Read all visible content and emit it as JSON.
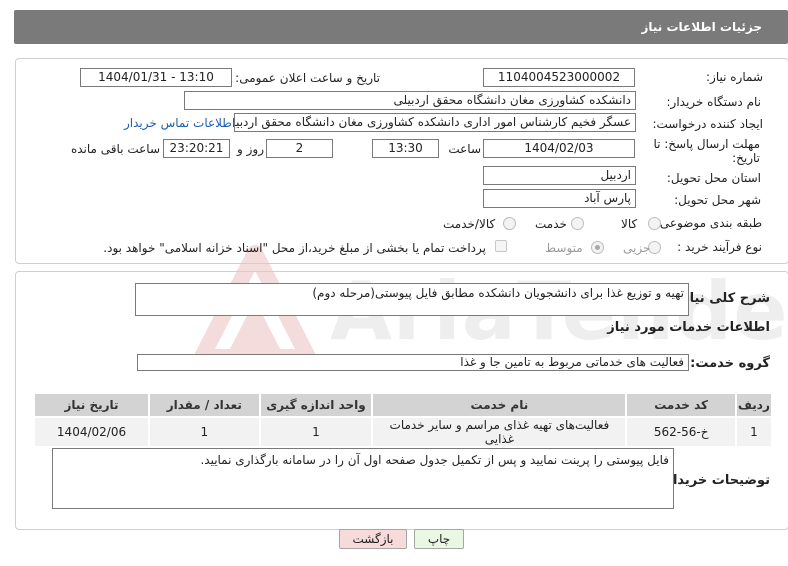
{
  "header": {
    "title": "جزئیات اطلاعات نیاز"
  },
  "labels": {
    "need_number": "شماره نیاز:",
    "announce_datetime": "تاریخ و ساعت اعلان عمومی:",
    "buyer_org": "نام دستگاه خریدار:",
    "requester": "ایجاد کننده درخواست:",
    "contact_link": "اطلاعات تماس خریدار",
    "deadline_line1": "مهلت ارسال پاسخ: تا",
    "deadline_line2": "تاریخ:",
    "hour": "ساعت",
    "day_and": "روز و",
    "hours_left": "ساعت باقی مانده",
    "province": "استان محل تحویل:",
    "city": "شهر محل تحویل:",
    "category": "طبقه بندی موضوعی:",
    "process": "نوع فرآیند خرید :",
    "need_desc": "شرح کلی نیاز:",
    "services_info": "اطلاعات خدمات مورد نیاز",
    "service_group": "گروه خدمت:",
    "buyer_notes": "توضیحات خریدار:"
  },
  "fields": {
    "need_number": "1104004523000002",
    "announce_datetime": "1404/01/31 - 13:10",
    "buyer_org": "دانشکده کشاورزی مغان دانشگاه محقق اردبیلی",
    "requester": "عسگر فخیم کارشناس امور اداری دانشکده کشاورزی مغان دانشگاه محقق اردبیلی",
    "deadline_date": "1404/02/03",
    "deadline_time": "13:30",
    "days_left": "2",
    "time_left": "23:20:21",
    "province": "اردبیل",
    "city": "پارس آباد",
    "need_desc": "تهیه و توزیع غذا برای دانشجویان دانشکده مطابق فایل پیوستی(مرحله دوم)",
    "service_group": "فعالیت های خدماتی مربوط به تامین جا و غذا",
    "buyer_notes": "فایل پیوستی را پرینت نمایید و پس از تکمیل جدول صفحه اول آن را در سامانه بارگذاری نمایید."
  },
  "category_options": [
    {
      "label": "کالا",
      "selected": false
    },
    {
      "label": "خدمت",
      "selected": false
    },
    {
      "label": "کالا/خدمت",
      "selected": false
    }
  ],
  "process_options": [
    {
      "label": "جزیی",
      "selected": false
    },
    {
      "label": "متوسط",
      "selected": true
    }
  ],
  "payment_note": "پرداخت تمام یا بخشی از مبلغ خرید،از محل \"اسناد خزانه اسلامی\" خواهد بود.",
  "services_table": {
    "headers": [
      "ردیف",
      "کد خدمت",
      "نام خدمت",
      "واحد اندازه گیری",
      "تعداد / مقدار",
      "تاریخ نیاز"
    ],
    "rows": [
      [
        "1",
        "خ-56-562",
        "فعالیت‌های تهیه غذای مراسم و سایر خدمات غذایی",
        "1",
        "1",
        "1404/02/06"
      ]
    ]
  },
  "buttons": {
    "print": "چاپ",
    "back": "بازگشت"
  },
  "watermark": "AriaTender.neT",
  "colors": {
    "header_bg": "#7a7a7a",
    "link": "#1c5fb0",
    "back_bg": "#f7dada",
    "print_bg": "#e9f7e3"
  }
}
